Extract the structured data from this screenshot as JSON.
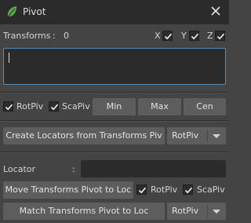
{
  "window": {
    "title": "Pivot",
    "icons": [
      "leaf-icon",
      "close-icon"
    ]
  },
  "transforms": {
    "label": "Transforms",
    "separator": ":",
    "count": "0",
    "axes": [
      {
        "label": "X",
        "checked": true
      },
      {
        "label": "Y",
        "checked": true
      },
      {
        "label": "Z",
        "checked": true
      }
    ],
    "text_value": ""
  },
  "options": {
    "rotpiv_label": "RotPiv",
    "rotpiv_checked": true,
    "scapiv_label": "ScaPiv",
    "scapiv_checked": true,
    "min_label": "Min",
    "max_label": "Max",
    "cen_label": "Cen"
  },
  "create_locators": {
    "button_label": "Create Locators from Transforms Piv",
    "dropdown_value": "RotPiv"
  },
  "locator": {
    "label": "Locator",
    "separator": ":",
    "value": "",
    "move_button_label": "Move Transforms Pivot to Loc",
    "rotpiv_label": "RotPiv",
    "rotpiv_checked": true,
    "scapiv_label": "ScaPiv",
    "scapiv_checked": true,
    "match_button_label": "Match Transforms Pivot to Loc",
    "match_dropdown_value": "RotPiv"
  },
  "colors": {
    "background": "#444444",
    "titlebar": "#2b2b2b",
    "button": "#5d5d5d",
    "field": "#2b2b2b",
    "focus_border": "#5a8ab2"
  }
}
